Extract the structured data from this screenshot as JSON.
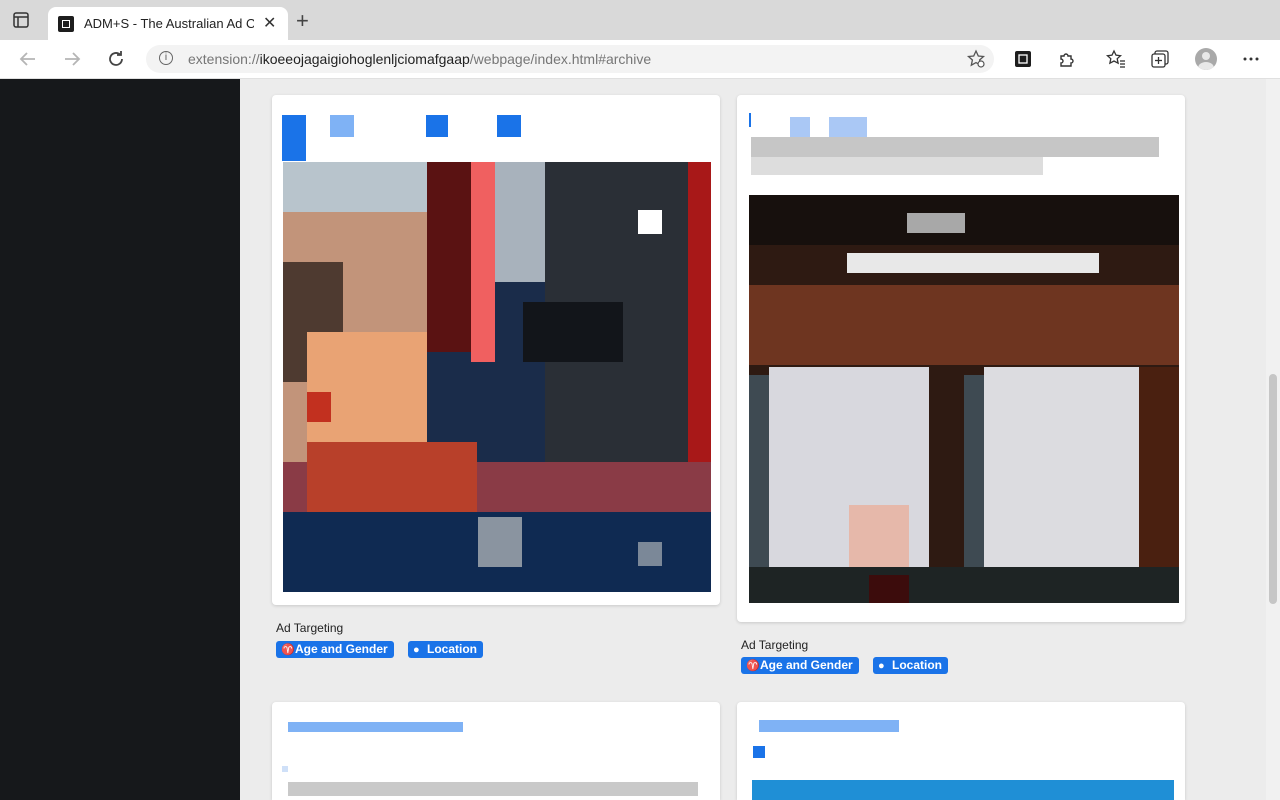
{
  "browser": {
    "tab_title": "ADM+S - The Australian Ad Ob",
    "tab_close": "✕",
    "new_tab": "+",
    "url_scheme": "extension://",
    "url_host": "ikoeeojagaigiohoglenljciomafgaap",
    "url_path": "/webpage/index.html#archive"
  },
  "ads": [
    {
      "targeting_label": "Ad Targeting",
      "chips": [
        "Age and Gender",
        "Location"
      ]
    },
    {
      "targeting_label": "Ad Targeting",
      "chips": [
        "Age and Gender",
        "Location"
      ]
    }
  ],
  "colors": {
    "accent": "#1a73e8",
    "sidebar": "#16181b",
    "page_bg": "#ececec"
  },
  "icons": {
    "chip_age_gender": "target-people-icon",
    "chip_location": "location-pin-icon"
  }
}
